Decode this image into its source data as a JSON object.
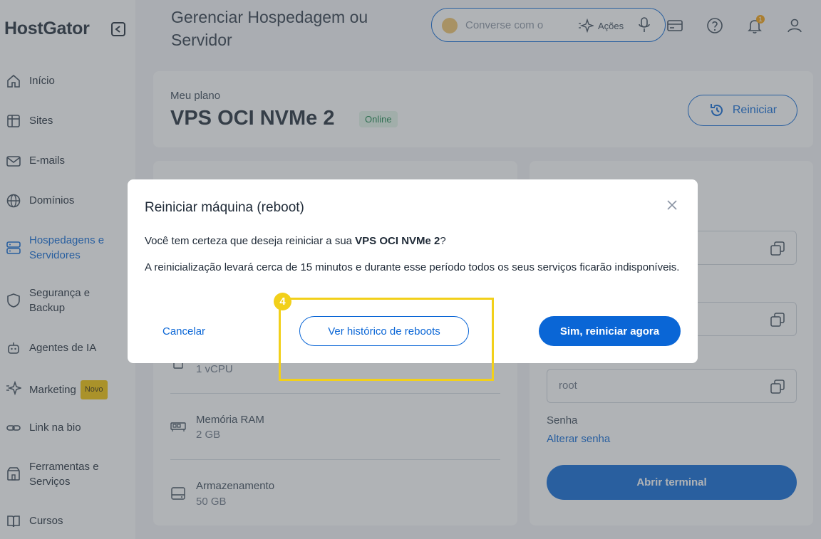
{
  "brand": {
    "logo": "HostGator"
  },
  "sidebar": {
    "items": [
      {
        "label": "Início",
        "icon": "home-icon"
      },
      {
        "label": "Sites",
        "icon": "sites-icon"
      },
      {
        "label": "E-mails",
        "icon": "mail-icon"
      },
      {
        "label": "Domínios",
        "icon": "globe-icon"
      },
      {
        "label": "Hospedagens e Servidores",
        "icon": "server-icon",
        "active": true
      },
      {
        "label": "Segurança e Backup",
        "icon": "shield-icon"
      },
      {
        "label": "Agentes de IA",
        "icon": "robot-icon"
      },
      {
        "label": "Marketing",
        "icon": "sparkle-icon",
        "badge": "Novo"
      },
      {
        "label": "Link na bio",
        "icon": "link-icon"
      },
      {
        "label": "Ferramentas e Serviços",
        "icon": "tools-icon"
      },
      {
        "label": "Cursos",
        "icon": "book-icon"
      }
    ]
  },
  "header": {
    "title": "Gerenciar Hospedagem ou Servidor",
    "chat_placeholder": "Converse com o",
    "chat_actions": "Ações",
    "notification_count": "1"
  },
  "plan": {
    "label": "Meu plano",
    "name": "VPS OCI NVMe 2",
    "status": "Online",
    "restart_label": "Reiniciar"
  },
  "specs": [
    {
      "label": "",
      "value": "1 vCPU",
      "icon": "cpu-icon"
    },
    {
      "label": "Memória RAM",
      "value": "2 GB",
      "icon": "memory-icon"
    },
    {
      "label": "Armazenamento",
      "value": "50 GB",
      "icon": "storage-icon"
    }
  ],
  "access": {
    "user_value": "root",
    "password_label": "Senha",
    "change_password": "Alterar senha",
    "terminal_button": "Abrir terminal"
  },
  "modal": {
    "title": "Reiniciar máquina (reboot)",
    "question_prefix": "Você tem certeza que deseja reiniciar a sua ",
    "question_bold": "VPS OCI NVMe 2",
    "question_suffix": "?",
    "description": "A reinicialização levará cerca de 15 minutos e durante esse período todos os seus serviços ficarão indisponíveis.",
    "cancel": "Cancelar",
    "history": "Ver histórico de reboots",
    "confirm": "Sim, reiniciar agora"
  },
  "annotation": {
    "step": "4",
    "color": "#f2d01a"
  },
  "colors": {
    "accent": "#0a66d6",
    "online": "#17844a",
    "badge": "#f5c400"
  }
}
